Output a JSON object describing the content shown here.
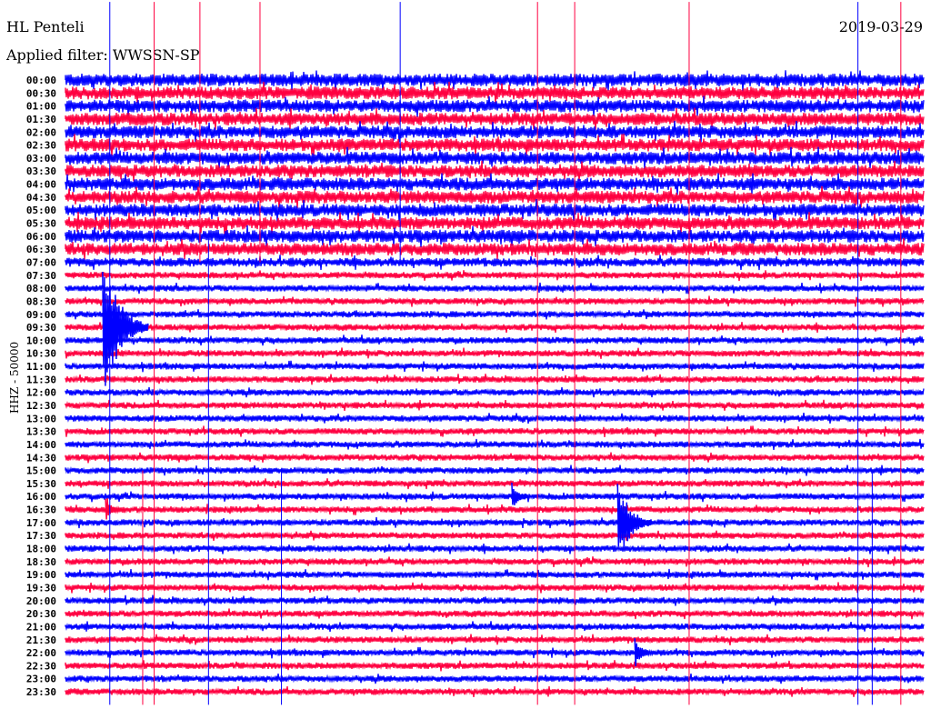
{
  "header": {
    "station": "HL Penteli",
    "filter": "Applied filter: WWSSN-SP",
    "date": "2019-03-29",
    "channel": "HHZ - 50000"
  },
  "chart_data": {
    "type": "helicorder",
    "title": "HL Penteli",
    "xlabel": "",
    "ylabel": "HHZ - 50000",
    "minutes_per_line": 30,
    "colors": {
      "even": "#0000ff",
      "odd": "#ff0040"
    },
    "rows": [
      "00:00",
      "00:30",
      "01:00",
      "01:30",
      "02:00",
      "02:30",
      "03:00",
      "03:30",
      "04:00",
      "04:30",
      "05:00",
      "05:30",
      "06:00",
      "06:30",
      "07:00",
      "07:30",
      "08:00",
      "08:30",
      "09:00",
      "09:30",
      "10:00",
      "10:30",
      "11:00",
      "11:30",
      "12:00",
      "12:30",
      "13:00",
      "13:30",
      "14:00",
      "14:30",
      "15:00",
      "15:30",
      "16:00",
      "16:30",
      "17:00",
      "17:30",
      "18:00",
      "18:30",
      "19:00",
      "19:30",
      "20:00",
      "20:30",
      "21:00",
      "21:30",
      "22:00",
      "22:30",
      "23:00",
      "23:30"
    ],
    "noise_level": [
      1.0,
      1.0,
      1.0,
      1.0,
      1.0,
      1.0,
      1.0,
      1.0,
      1.0,
      1.0,
      1.0,
      1.0,
      1.0,
      1.0,
      0.7,
      0.5,
      0.5,
      0.5,
      0.5,
      0.5,
      0.5,
      0.5,
      0.5,
      0.5,
      0.5,
      0.5,
      0.5,
      0.5,
      0.5,
      0.5,
      0.5,
      0.5,
      0.5,
      0.5,
      0.5,
      0.5,
      0.5,
      0.5,
      0.5,
      0.5,
      0.5,
      0.5,
      0.5,
      0.5,
      0.5,
      0.5,
      0.5,
      0.5
    ],
    "events": [
      {
        "row": 19,
        "minute": 1.3,
        "duration_min": 1.6,
        "amplitude": 6.0,
        "color": "#0000ff"
      },
      {
        "row": 34,
        "minute": 19.3,
        "duration_min": 1.2,
        "amplitude": 3.5,
        "color": "#0000ff"
      },
      {
        "row": 32,
        "minute": 15.6,
        "duration_min": 0.6,
        "amplitude": 1.2,
        "color": "#0000ff"
      },
      {
        "row": 33,
        "minute": 1.4,
        "duration_min": 0.6,
        "amplitude": 1.2,
        "color": "#ff0040"
      },
      {
        "row": 44,
        "minute": 19.9,
        "duration_min": 0.8,
        "amplitude": 1.2,
        "color": "#0000ff"
      }
    ],
    "spikes": [
      {
        "minute": 1.55,
        "from": -6,
        "to": 48,
        "color": "#0000ff"
      },
      {
        "minute": 3.1,
        "from": -6,
        "to": 48,
        "color": "#ff0040"
      },
      {
        "minute": 2.7,
        "from": 30,
        "to": 48,
        "color": "#ff0040"
      },
      {
        "minute": 5.0,
        "from": 12,
        "to": 48,
        "color": "#0000ff"
      },
      {
        "minute": 4.7,
        "from": -6,
        "to": 14,
        "color": "#ff0040"
      },
      {
        "minute": 6.8,
        "from": -6,
        "to": 14,
        "color": "#ff0040"
      },
      {
        "minute": 7.55,
        "from": 30,
        "to": 48,
        "color": "#0000ff"
      },
      {
        "minute": 11.7,
        "from": -6,
        "to": 14,
        "color": "#0000ff"
      },
      {
        "minute": 16.5,
        "from": -6,
        "to": 48,
        "color": "#ff0040"
      },
      {
        "minute": 17.8,
        "from": -6,
        "to": 48,
        "color": "#ff0040"
      },
      {
        "minute": 21.8,
        "from": -6,
        "to": 48,
        "color": "#ff0040"
      },
      {
        "minute": 27.7,
        "from": -6,
        "to": 48,
        "color": "#0000ff"
      },
      {
        "minute": 29.2,
        "from": -6,
        "to": 48,
        "color": "#ff0040"
      },
      {
        "minute": 28.2,
        "from": 30,
        "to": 48,
        "color": "#0000ff"
      }
    ]
  }
}
